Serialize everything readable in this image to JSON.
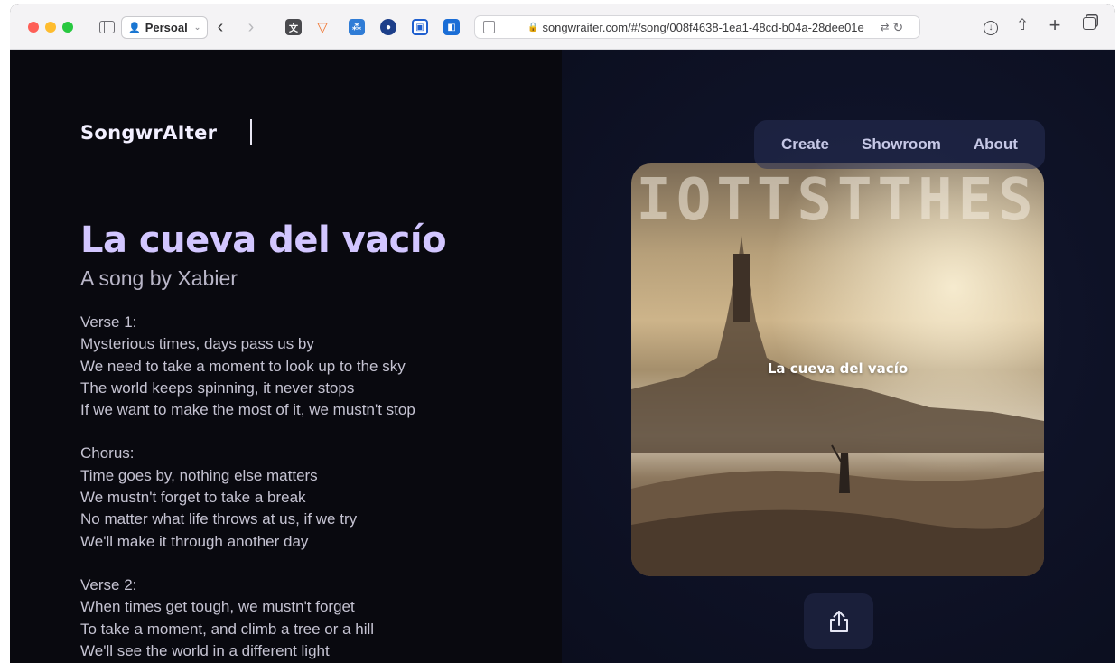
{
  "browser": {
    "profile_label": "Persoal",
    "url": "songwraiter.com/#/song/008f4638-1ea1-48cd-b04a-28dee01e",
    "extensions": [
      "translate-ext-icon",
      "shield-ext-icon",
      "grid-ext-icon",
      "circle-ext-icon",
      "bookmark-ext-icon",
      "badge-ext-icon"
    ]
  },
  "site": {
    "logo": "SongwrAIter",
    "nav": [
      {
        "label": "Create"
      },
      {
        "label": "Showroom"
      },
      {
        "label": "About"
      }
    ]
  },
  "song": {
    "title": "La cueva del vacío",
    "subtitle": "A song by Xabier",
    "cover_caption": "La cueva del vacío",
    "cover_top_text": "IOTTSTTHES",
    "stanzas": [
      {
        "lines": [
          "Verse 1:",
          "Mysterious times, days pass us by",
          "We need to take a moment to look up to the sky",
          "The world keeps spinning, it never stops",
          "If we want to make the most of it, we mustn't stop"
        ]
      },
      {
        "lines": [
          "Chorus:",
          "Time goes by, nothing else matters",
          "We mustn't forget to take a break",
          "No matter what life throws at us, if we try",
          "We'll make it through another day"
        ]
      },
      {
        "lines": [
          "Verse 2:",
          "When times get tough, we mustn't forget",
          "To take a moment, and climb a tree or a hill",
          "We'll see the world in a different light"
        ]
      }
    ]
  },
  "colors": {
    "title": "#d2c6ff",
    "left_bg": "#09090f",
    "right_bg": "#0f1328"
  }
}
